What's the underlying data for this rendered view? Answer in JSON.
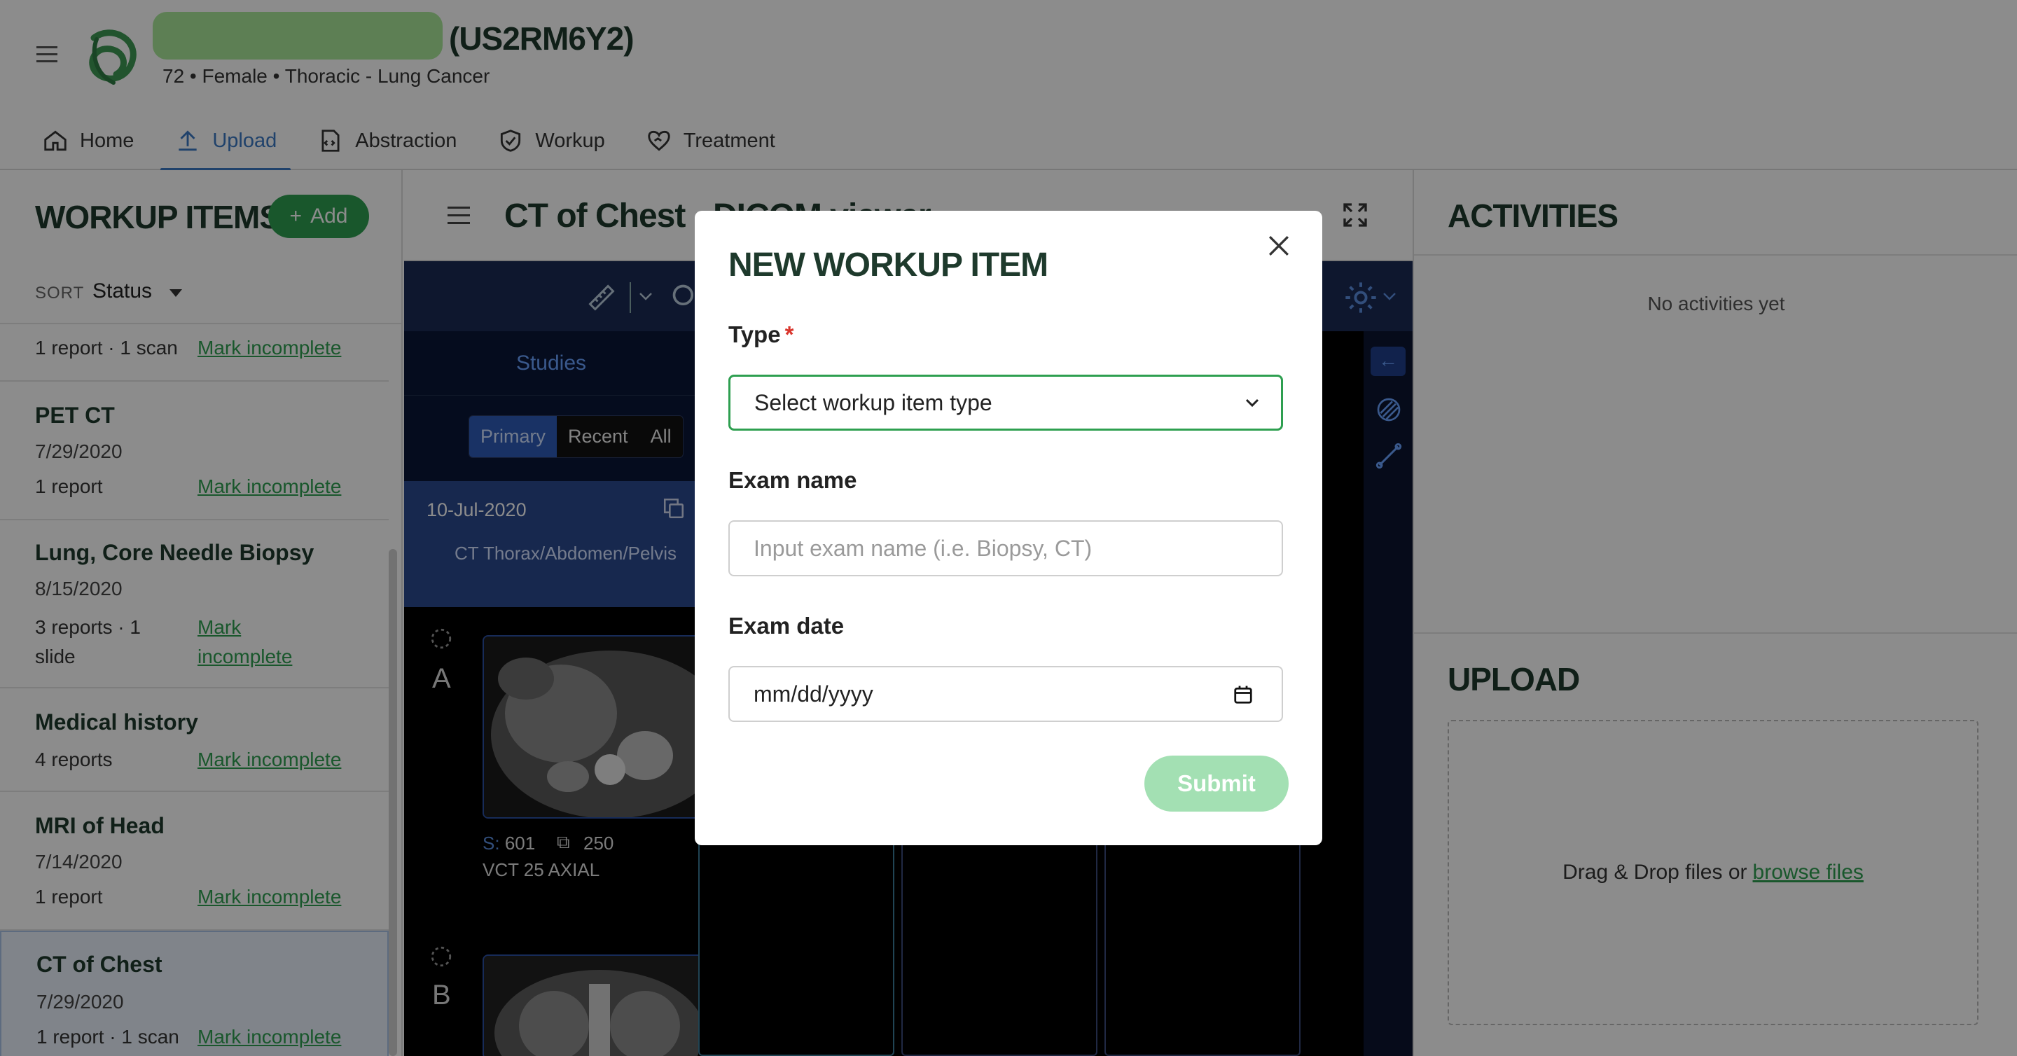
{
  "header": {
    "patient_id": "(US2RM6Y2)",
    "patient_summary": "72 • Female • Thoracic - Lung Cancer",
    "tabs": [
      {
        "label": "Home",
        "icon": "home-icon"
      },
      {
        "label": "Upload",
        "icon": "upload-icon",
        "active": true
      },
      {
        "label": "Abstraction",
        "icon": "abstraction-icon"
      },
      {
        "label": "Workup",
        "icon": "shield-check-icon"
      },
      {
        "label": "Treatment",
        "icon": "heart-hand-icon"
      }
    ]
  },
  "workup": {
    "title": "WORKUP ITEMS",
    "add_label": "Add",
    "sort_label": "SORT",
    "sort_value": "Status",
    "mark_label": "Mark incomplete",
    "items": [
      {
        "name": "",
        "date": "",
        "meta": "1 report · 1 scan"
      },
      {
        "name": "PET CT",
        "date": "7/29/2020",
        "meta": "1 report"
      },
      {
        "name": "Lung, Core Needle Biopsy",
        "date": "8/15/2020",
        "meta": "3 reports · 1 slide"
      },
      {
        "name": "Medical history",
        "date": "",
        "meta": "4 reports"
      },
      {
        "name": "MRI of Head",
        "date": "7/14/2020",
        "meta": "1 report"
      },
      {
        "name": "CT of Chest",
        "date": "7/29/2020",
        "meta": "1 report · 1 scan",
        "selected": true
      }
    ],
    "mark_wrap": [
      "Mark",
      "incomplete"
    ]
  },
  "viewer": {
    "title": "CT of Chest - DICOM viewer",
    "studies_label": "Studies",
    "study_tabs": [
      "Primary",
      "Recent",
      "All"
    ],
    "study_date": "10-Jul-2020",
    "study_desc": "CT Thorax/Abdomen/Pelvis",
    "series": [
      {
        "letter": "A",
        "s_label": "S:",
        "s_num": "601",
        "count": "250",
        "desc": "VCT 25 AXIAL"
      },
      {
        "letter": "B"
      }
    ]
  },
  "activities": {
    "title": "ACTIVITIES",
    "empty": "No activities yet"
  },
  "upload": {
    "title": "UPLOAD",
    "drop_text": "Drag & Drop files or",
    "browse_text": "browse files"
  },
  "modal": {
    "title": "NEW WORKUP ITEM",
    "type_label": "Type",
    "required_mark": "*",
    "type_placeholder": "Select workup item type",
    "exam_name_label": "Exam name",
    "exam_name_placeholder": "Input exam name (i.e. Biopsy, CT)",
    "exam_date_label": "Exam date",
    "exam_date_placeholder": "mm/dd/yyyy",
    "submit_label": "Submit"
  },
  "colors": {
    "brand_green": "#2e9f50",
    "heading_dark": "#1e3a2c",
    "active_tab_blue": "#3b78c4",
    "submit_disabled": "#a3e0b3"
  }
}
